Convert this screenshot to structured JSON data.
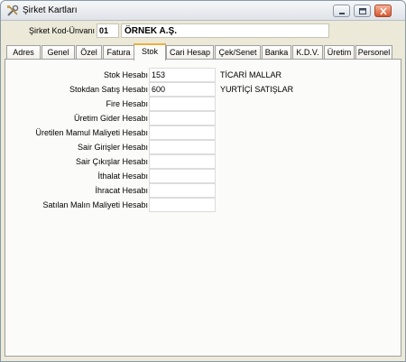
{
  "window": {
    "title": "Şirket Kartları",
    "icon": "wrench-tools-icon",
    "buttons": [
      "minimize",
      "maximize",
      "close"
    ]
  },
  "company": {
    "label": "Şirket Kod-Ünvanı",
    "code": "01",
    "name": "ÖRNEK A.Ş."
  },
  "tabs": [
    {
      "label": "Adres",
      "active": false
    },
    {
      "label": "Genel",
      "active": false
    },
    {
      "label": "Özel",
      "active": false
    },
    {
      "label": "Fatura",
      "active": false
    },
    {
      "label": "Stok",
      "active": true
    },
    {
      "label": "Cari Hesap",
      "active": false
    },
    {
      "label": "Çek/Senet",
      "active": false
    },
    {
      "label": "Banka",
      "active": false
    },
    {
      "label": "K.D.V.",
      "active": false
    },
    {
      "label": "Üretim",
      "active": false
    },
    {
      "label": "Personel",
      "active": false
    }
  ],
  "stok_fields": [
    {
      "label": "Stok Hesabı",
      "value": "153",
      "description": "TİCARİ MALLAR"
    },
    {
      "label": "Stokdan Satış Hesabı",
      "value": "600",
      "description": "YURTİÇİ SATIŞLAR"
    },
    {
      "label": "Fire Hesabı",
      "value": "",
      "description": ""
    },
    {
      "label": "Üretim Gider Hesabı",
      "value": "",
      "description": ""
    },
    {
      "label": "Üretilen Mamul Maliyeti Hesabı",
      "value": "",
      "description": ""
    },
    {
      "label": "Sair Girişler Hesabı",
      "value": "",
      "description": ""
    },
    {
      "label": "Sair Çıkışlar Hesabı",
      "value": "",
      "description": ""
    },
    {
      "label": "İthalat Hesabı",
      "value": "",
      "description": ""
    },
    {
      "label": "İhracat Hesabı",
      "value": "",
      "description": ""
    },
    {
      "label": "Satılan Malın Maliyeti Hesabı",
      "value": "",
      "description": ""
    }
  ],
  "colors": {
    "window_bg": "#ece9d8",
    "panel_bg": "#fbfbf9",
    "active_tab_accent": "#f0b03c",
    "close_button": "#d4552b"
  }
}
